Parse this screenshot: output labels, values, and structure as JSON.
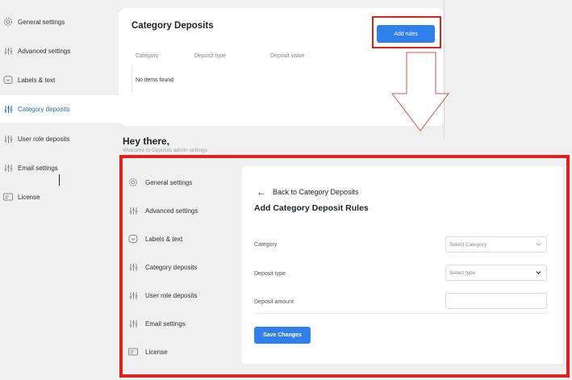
{
  "sidebar": {
    "items": [
      {
        "label": "General settings",
        "icon": "gear-icon"
      },
      {
        "label": "Advanced settings",
        "icon": "sliders-icon"
      },
      {
        "label": "Labels & text",
        "icon": "chat-bubble-icon"
      },
      {
        "label": "Category deposits",
        "icon": "sliders-icon",
        "active": true
      },
      {
        "label": "User role deposits",
        "icon": "sliders-icon"
      },
      {
        "label": "Email settings",
        "icon": "sliders-icon"
      },
      {
        "label": "License",
        "icon": "license-card-icon"
      }
    ]
  },
  "category_page": {
    "title": "Category Deposits",
    "add_button": "Add rules",
    "columns": [
      "Category",
      "Deposit type",
      "Deposit value"
    ],
    "empty_text": "No items found"
  },
  "greeting": {
    "title": "Hey there,",
    "subtitle": "Welcome to Deposits admin settings"
  },
  "form": {
    "back_label": "Back to Category Deposits",
    "title": "Add Category Deposit Rules",
    "category_label": "Category",
    "category_placeholder": "Select Category",
    "deposit_type_label": "Deposit type",
    "deposit_type_placeholder": "Select type",
    "deposit_amount_label": "Deposit amount",
    "deposit_amount_value": "",
    "save_button": "Save Changes"
  },
  "colors": {
    "accent": "#2f80ed",
    "active_nav": "#2271b1",
    "highlight": "#e0201b",
    "background": "#f0f0f1"
  }
}
